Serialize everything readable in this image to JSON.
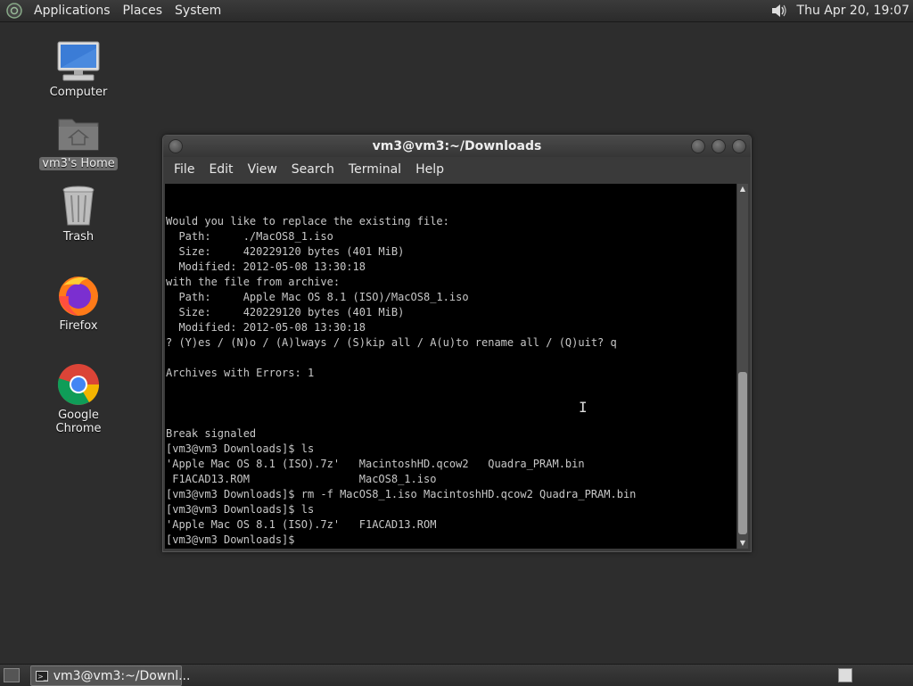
{
  "top_panel": {
    "menus": [
      "Applications",
      "Places",
      "System"
    ],
    "clock": "Thu Apr 20, 19:07",
    "volume_icon": "speaker-icon"
  },
  "desktop": {
    "icons": [
      {
        "label": "Computer",
        "icon": "computer-icon"
      },
      {
        "label": "vm3's Home",
        "icon": "home-folder-icon"
      },
      {
        "label": "Trash",
        "icon": "trash-icon"
      },
      {
        "label": "Firefox",
        "icon": "firefox-icon"
      },
      {
        "label": "Google Chrome",
        "icon": "chrome-icon"
      }
    ]
  },
  "terminal": {
    "title": "vm3@vm3:~/Downloads",
    "menu": [
      "File",
      "Edit",
      "View",
      "Search",
      "Terminal",
      "Help"
    ],
    "lines": [
      "",
      "",
      "Would you like to replace the existing file:",
      "  Path:     ./MacOS8_1.iso",
      "  Size:     420229120 bytes (401 MiB)",
      "  Modified: 2012-05-08 13:30:18",
      "with the file from archive:",
      "  Path:     Apple Mac OS 8.1 (ISO)/MacOS8_1.iso",
      "  Size:     420229120 bytes (401 MiB)",
      "  Modified: 2012-05-08 13:30:18",
      "? (Y)es / (N)o / (A)lways / (S)kip all / A(u)to rename all / (Q)uit? q",
      "",
      "Archives with Errors: 1",
      "",
      "",
      "",
      "Break signaled",
      "[vm3@vm3 Downloads]$ ls",
      "'Apple Mac OS 8.1 (ISO).7z'   MacintoshHD.qcow2   Quadra_PRAM.bin",
      " F1ACAD13.ROM                 MacOS8_1.iso",
      "[vm3@vm3 Downloads]$ rm -f MacOS8_1.iso MacintoshHD.qcow2 Quadra_PRAM.bin",
      "[vm3@vm3 Downloads]$ ls",
      "'Apple Mac OS 8.1 (ISO).7z'   F1ACAD13.ROM",
      "[vm3@vm3 Downloads]$ "
    ]
  },
  "taskbar": {
    "task_label": "vm3@vm3:~/Downl..."
  }
}
